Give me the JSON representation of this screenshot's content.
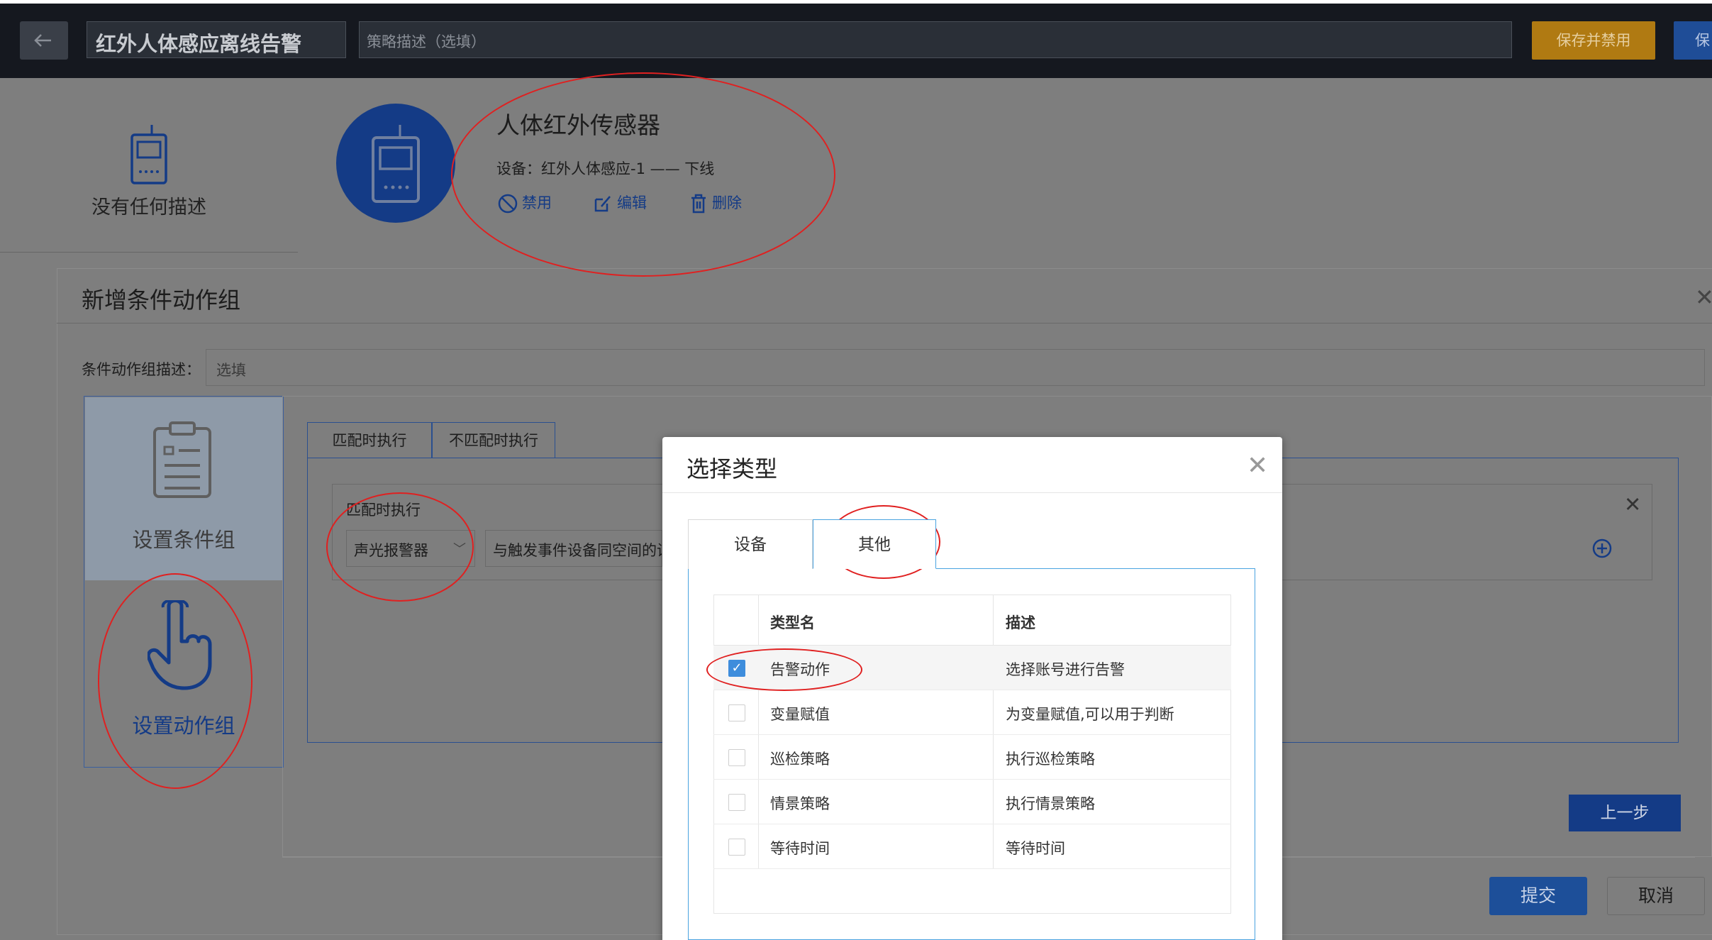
{
  "topbar": {
    "title": "红外人体感应离线告警",
    "description_placeholder": "策略描述（选填）",
    "save_disable_label": "保存并禁用",
    "save_label": "保"
  },
  "header": {
    "no_description": "没有任何描述",
    "sensor_title": "人体红外传感器",
    "device_line": "设备：红外人体感应-1 —— 下线",
    "actions": {
      "disable": "禁用",
      "edit": "编辑",
      "delete": "删除"
    }
  },
  "condition_modal": {
    "title": "新增条件动作组",
    "desc_label": "条件动作组描述：",
    "desc_placeholder": "选填",
    "steps": {
      "set_condition": "设置条件组",
      "set_action": "设置动作组"
    },
    "tabs": {
      "match": "匹配时执行",
      "no_match": "不匹配时执行"
    },
    "match_panel": {
      "label": "匹配时执行",
      "device_select": "声光报警器",
      "space_select": "与触发事件设备同空间的设"
    },
    "prev_label": "上一步",
    "submit_label": "提交",
    "cancel_label": "取消"
  },
  "select_type_dialog": {
    "title": "选择类型",
    "tabs": {
      "device": "设备",
      "other": "其他"
    },
    "columns": {
      "name": "类型名",
      "description": "描述"
    },
    "rows": [
      {
        "name": "告警动作",
        "description": "选择账号进行告警",
        "checked": true
      },
      {
        "name": "变量赋值",
        "description": "为变量赋值,可以用于判断",
        "checked": false
      },
      {
        "name": "巡检策略",
        "description": "执行巡检策略",
        "checked": false
      },
      {
        "name": "情景策略",
        "description": "执行情景策略",
        "checked": false
      },
      {
        "name": "等待时间",
        "description": "等待时间",
        "checked": false
      }
    ]
  },
  "colors": {
    "primary_blue": "#143b86",
    "accent_blue": "#3e8ddc",
    "tab_border_blue": "#4aa3e0",
    "orange": "#b07a12",
    "annotation_red": "#e02020"
  }
}
